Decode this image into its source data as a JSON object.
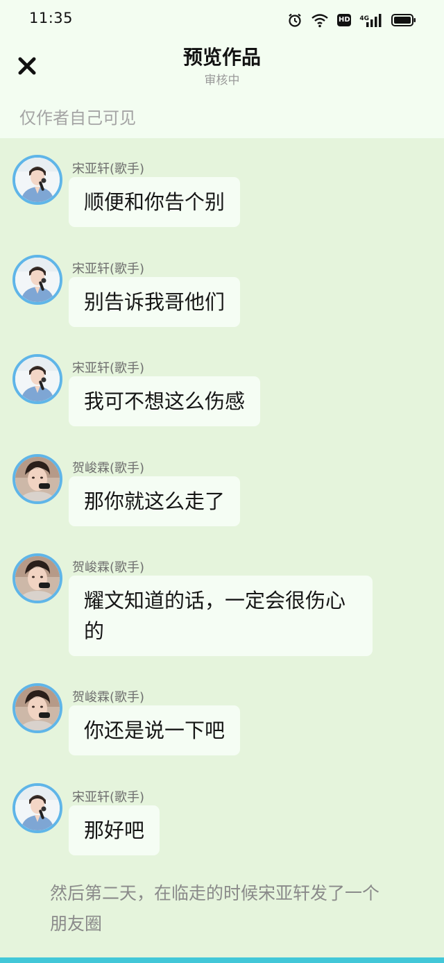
{
  "status_bar": {
    "time": "11:35",
    "network_label": "4G",
    "hd_label": "HD"
  },
  "header": {
    "title": "预览作品",
    "subtitle": "审核中",
    "visibility_note": "仅作者自己可见"
  },
  "messages": [
    {
      "sender": "宋亚轩(歌手)",
      "text": "顺便和你告个别",
      "avatar": "songyaxuan"
    },
    {
      "sender": "宋亚轩(歌手)",
      "text": "别告诉我哥他们",
      "avatar": "songyaxuan"
    },
    {
      "sender": "宋亚轩(歌手)",
      "text": "我可不想这么伤感",
      "avatar": "songyaxuan"
    },
    {
      "sender": "贺峻霖(歌手)",
      "text": "那你就这么走了",
      "avatar": "hejunlin"
    },
    {
      "sender": "贺峻霖(歌手)",
      "text": "耀文知道的话，一定会很伤心的",
      "avatar": "hejunlin"
    },
    {
      "sender": "贺峻霖(歌手)",
      "text": "你还是说一下吧",
      "avatar": "hejunlin"
    },
    {
      "sender": "宋亚轩(歌手)",
      "text": "那好吧",
      "avatar": "songyaxuan"
    }
  ],
  "narration": "然后第二天，在临走的时候宋亚轩发了一个朋友圈",
  "colors": {
    "header_bg": "#f3fdf1",
    "chat_bg": "#e5f4dc",
    "bubble_bg": "#f5fdf4",
    "avatar_ring": "#5fb5e8",
    "bottom_strip": "#42c7d8"
  }
}
